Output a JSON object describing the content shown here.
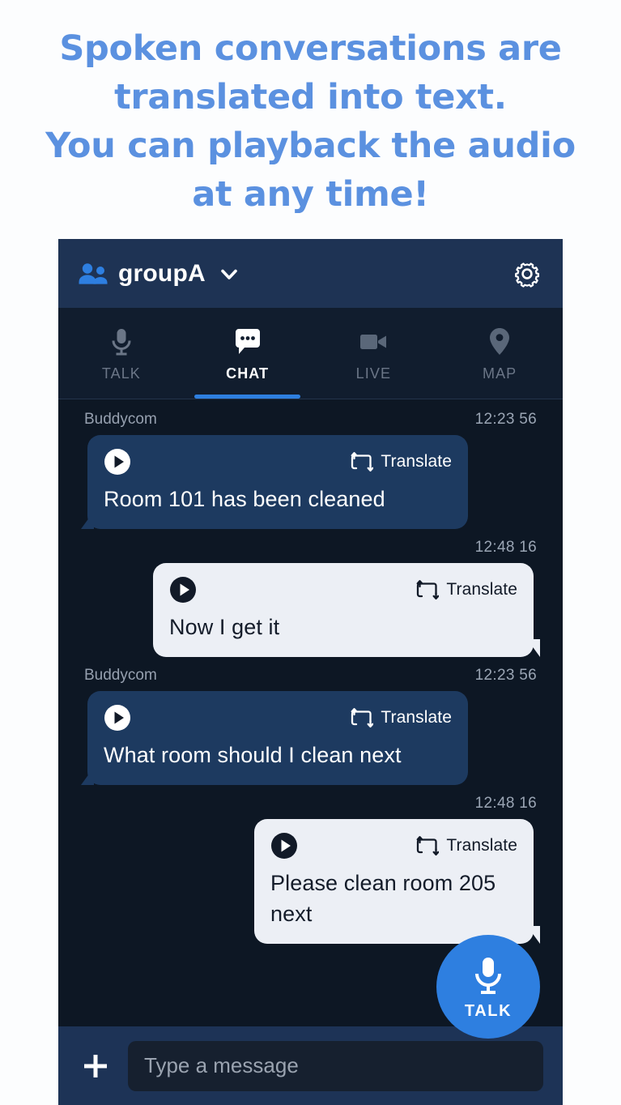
{
  "headline": {
    "lines": [
      "Spoken conversations are",
      "translated into text.",
      "You can playback the audio",
      "at any time!"
    ],
    "color": "#5b91e0"
  },
  "app": {
    "header": {
      "group_name": "groupA",
      "group_icon": "people-icon",
      "chevron_icon": "chevron-down-icon",
      "settings_icon": "gear-icon",
      "background": "#1e3354",
      "accent": "#2e7fe0"
    },
    "tabs": [
      {
        "label": "TALK",
        "icon": "microphone-icon",
        "active": false
      },
      {
        "label": "CHAT",
        "icon": "chat-bubble-icon",
        "active": true
      },
      {
        "label": "LIVE",
        "icon": "video-camera-icon",
        "active": false
      },
      {
        "label": "MAP",
        "icon": "map-pin-icon",
        "active": false
      }
    ],
    "messages": [
      {
        "sender": "Buddycom",
        "time": "12:23 56",
        "direction": "incoming",
        "play_icon": "play-icon",
        "translate_label": "Translate",
        "translate_icon": "translate-loop-icon",
        "text": "Room 101 has been cleaned"
      },
      {
        "sender": "",
        "time": "12:48 16",
        "direction": "outgoing",
        "play_icon": "play-icon",
        "translate_label": "Translate",
        "translate_icon": "translate-loop-icon",
        "text": "Now I get it"
      },
      {
        "sender": "Buddycom",
        "time": "12:23 56",
        "direction": "incoming",
        "play_icon": "play-icon",
        "translate_label": "Translate",
        "translate_icon": "translate-loop-icon",
        "text": "What room should I clean next"
      },
      {
        "sender": "",
        "time": "12:48 16",
        "direction": "outgoing",
        "play_icon": "play-icon",
        "translate_label": "Translate",
        "translate_icon": "translate-loop-icon",
        "text": "Please clean room 205 next"
      }
    ],
    "talk_button": {
      "label": "TALK",
      "icon": "microphone-icon",
      "color": "#2e7fe0"
    },
    "composer": {
      "add_icon": "plus-icon",
      "input_value": "",
      "input_placeholder": "Type a message"
    }
  }
}
